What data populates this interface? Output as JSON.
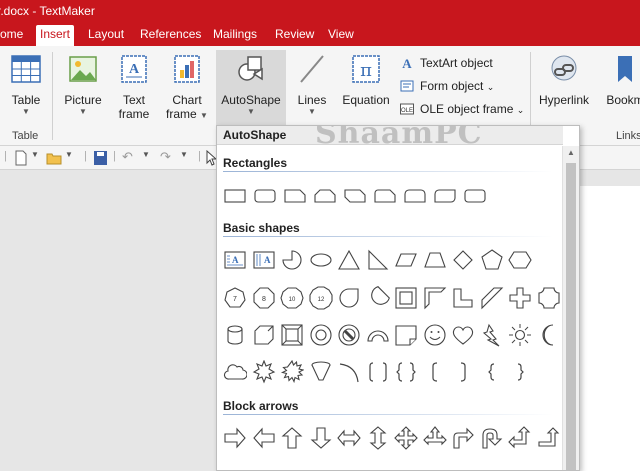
{
  "window": {
    "title": "r.docx - TextMaker"
  },
  "tabs": [
    "ome",
    "Insert",
    "Layout",
    "References",
    "Mailings",
    "Review",
    "View"
  ],
  "ribbon": {
    "table": {
      "label": "Table",
      "group": "Table"
    },
    "picture": {
      "label": "Picture"
    },
    "text_frame": {
      "label": "Text\nframe"
    },
    "chart_frame": {
      "label": "Chart\nframe"
    },
    "autoshape": {
      "label": "AutoShape"
    },
    "lines": {
      "label": "Lines"
    },
    "equation": {
      "label": "Equation"
    },
    "textart": {
      "label": "TextArt object"
    },
    "form_object": {
      "label": "Form object"
    },
    "ole_frame": {
      "label": "OLE object frame"
    },
    "hyperlink": {
      "label": "Hyperlink"
    },
    "bookmark": {
      "label": "Bookm"
    },
    "links_group": "Links"
  },
  "autoshape_menu": {
    "title": "AutoShape",
    "watermark": "ShaamPC",
    "sections": {
      "rectangles": "Rectangles",
      "basic_shapes": "Basic shapes",
      "block_arrows": "Block arrows"
    }
  },
  "colors": {
    "brand": "#c8161d",
    "ribbon_bg": "#f5f5f5"
  }
}
